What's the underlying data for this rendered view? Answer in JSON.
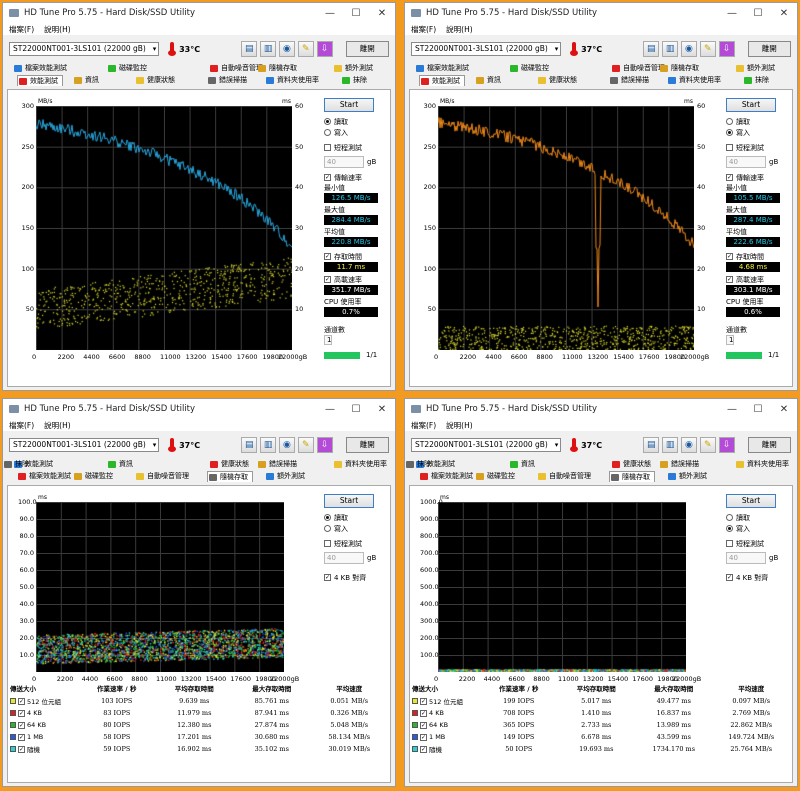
{
  "windows": [
    {
      "title": "HD Tune Pro 5.75 - Hard Disk/SSD Utility",
      "menu": [
        "檔案(F)",
        "說明(H)"
      ],
      "drive": "ST22000NT001-3LS101 (22000 gB)",
      "temperature": "33°C",
      "exit_label": "離開",
      "tabs_row1": [
        "檔案效能測試",
        "磁碟監控",
        "自動噪音管理",
        "隨機存取",
        "額外測試"
      ],
      "tabs_row2": [
        "效能測試",
        "資訊",
        "健康狀態",
        "錯誤掃描",
        "資料夾使用率",
        "抹除"
      ],
      "selected_tab": "效能測試",
      "start_label": "Start",
      "mode_options": [
        "讀取",
        "寫入"
      ],
      "mode_selected": 0,
      "short_test_label": "短程測試",
      "short_test_value": "40",
      "short_test_unit": "gB",
      "transfer_rate_label": "傳輸速率",
      "min_label": "最小值",
      "min_value": "126.5 MB/s",
      "max_label": "最大值",
      "max_value": "284.4 MB/s",
      "avg_label": "平均值",
      "avg_value": "220.8 MB/s",
      "access_label": "存取時間",
      "access_value": "11.7 ms",
      "burst_label": "高載速率",
      "burst_value": "351.7 MB/s",
      "cpu_label": "CPU 使用率",
      "cpu_value": "0.7%",
      "passes_label": "通道數",
      "passes_value": "1",
      "progress_text": "1/1",
      "progress": 1.0,
      "line_color": "#29a8e0",
      "chart_data": {
        "type": "line",
        "ylabel": "MB/s",
        "y2label": "ms",
        "ylim": [
          0,
          300
        ],
        "y2lim": [
          0,
          60
        ],
        "yticks": [
          50,
          100,
          150,
          200,
          250,
          300
        ],
        "y2ticks": [
          10,
          20,
          30,
          40,
          50,
          60
        ],
        "xticks": [
          "0",
          "2200",
          "4400",
          "6600",
          "8800",
          "11000",
          "13200",
          "15400",
          "17600",
          "19800",
          "22000gB"
        ],
        "xlim": [
          0,
          22000
        ],
        "series": [
          {
            "x": [
              0,
              2200,
              4400,
              6600,
              8800,
              11000,
              13200,
              15400,
              17600,
              19800,
              22000
            ],
            "values": [
              278,
              272,
              266,
              258,
              248,
              236,
              222,
              206,
              187,
              161,
              127
            ]
          }
        ]
      }
    },
    {
      "title": "HD Tune Pro 5.75 - Hard Disk/SSD Utility",
      "menu": [
        "檔案(F)",
        "說明(H)"
      ],
      "drive": "ST22000NT001-3LS101 (22000 gB)",
      "temperature": "37°C",
      "exit_label": "離開",
      "tabs_row1": [
        "檔案效能測試",
        "磁碟監控",
        "自動噪音管理",
        "隨機存取",
        "額外測試"
      ],
      "tabs_row2": [
        "效能測試",
        "資訊",
        "健康狀態",
        "錯誤掃描",
        "資料夾使用率",
        "抹除"
      ],
      "selected_tab": "效能測試",
      "start_label": "Start",
      "mode_options": [
        "讀取",
        "寫入"
      ],
      "mode_selected": 1,
      "short_test_label": "短程測試",
      "short_test_value": "40",
      "short_test_unit": "gB",
      "transfer_rate_label": "傳輸速率",
      "min_label": "最小值",
      "min_value": "105.5 MB/s",
      "max_label": "最大值",
      "max_value": "287.4 MB/s",
      "avg_label": "平均值",
      "avg_value": "222.6 MB/s",
      "access_label": "存取時間",
      "access_value": "4.68 ms",
      "burst_label": "高載速率",
      "burst_value": "303.1 MB/s",
      "cpu_label": "CPU 使用率",
      "cpu_value": "0.6%",
      "passes_label": "通道數",
      "passes_value": "1",
      "progress_text": "1/1",
      "progress": 1.0,
      "line_color": "#f08a1a",
      "chart_data": {
        "type": "line",
        "ylabel": "MB/s",
        "y2label": "ms",
        "ylim": [
          0,
          300
        ],
        "y2lim": [
          0,
          60
        ],
        "yticks": [
          50,
          100,
          150,
          200,
          250,
          300
        ],
        "y2ticks": [
          10,
          20,
          30,
          40,
          50,
          60
        ],
        "xticks": [
          "0",
          "2200",
          "4400",
          "6600",
          "8800",
          "11000",
          "13200",
          "15400",
          "17600",
          "19800",
          "22000gB"
        ],
        "xlim": [
          0,
          22000
        ],
        "series": [
          {
            "x": [
              0,
              2200,
              4400,
              6600,
              8800,
              11000,
              13200,
              15400,
              17600,
              19800,
              22000
            ],
            "values": [
              280,
              274,
              268,
              260,
              250,
              238,
              224,
              207,
              188,
              162,
              130
            ]
          }
        ]
      }
    },
    {
      "title": "HD Tune Pro 5.75 - Hard Disk/SSD Utility",
      "menu": [
        "檔案(F)",
        "說明(H)"
      ],
      "drive": "ST22000NT001-3LS101 (22000 gB)",
      "temperature": "37°C",
      "exit_label": "離開",
      "tabs_row1": [
        "效能測試",
        "資訊",
        "健康狀態",
        "錯誤掃描",
        "資料夾使用率",
        "抹除"
      ],
      "tabs_row2": [
        "檔案效能測試",
        "磁碟監控",
        "自動噪音管理",
        "隨機存取",
        "額外測試"
      ],
      "selected_tab": "隨機存取",
      "start_label": "Start",
      "mode_options": [
        "讀取",
        "寫入"
      ],
      "mode_selected": 0,
      "short_test_label": "短程測試",
      "short_test_value": "40",
      "short_test_unit": "gB",
      "align_label": "4 KB 對齊",
      "table_headers": [
        "傳送大小",
        "作業速率 / 秒",
        "平均存取時間",
        "最大存取時間",
        "平均速度"
      ],
      "table_rows": [
        {
          "label": "512 位元組",
          "color": "#e8e82a",
          "ops": "103 IOPS",
          "avg": "9.639 ms",
          "max": "85.761 ms",
          "speed": "0.051 MB/s"
        },
        {
          "label": "4 KB",
          "color": "#e02020",
          "ops": "83 IOPS",
          "avg": "11.979 ms",
          "max": "87.941 ms",
          "speed": "0.326 MB/s"
        },
        {
          "label": "64 KB",
          "color": "#2ab82a",
          "ops": "80 IOPS",
          "avg": "12.380 ms",
          "max": "27.874 ms",
          "speed": "5.048 MB/s"
        },
        {
          "label": "1 MB",
          "color": "#2a5ae0",
          "ops": "58 IOPS",
          "avg": "17.201 ms",
          "max": "30.680 ms",
          "speed": "58.134 MB/s"
        },
        {
          "label": "隨機",
          "color": "#2ad0d0",
          "ops": "59 IOPS",
          "avg": "16.902 ms",
          "max": "35.102 ms",
          "speed": "30.019 MB/s"
        }
      ],
      "chart_data": {
        "type": "scatter",
        "ylabel": "ms",
        "ylim": [
          0,
          100
        ],
        "yticks": [
          "10.0",
          "20.0",
          "30.0",
          "40.0",
          "50.0",
          "60.0",
          "70.0",
          "80.0",
          "90.0",
          "100.0"
        ],
        "xticks": [
          "0",
          "2200",
          "4400",
          "6600",
          "8800",
          "11000",
          "13200",
          "15400",
          "17600",
          "19800",
          "22000gB"
        ],
        "xlim": [
          0,
          22000
        ]
      }
    },
    {
      "title": "HD Tune Pro 5.75 - Hard Disk/SSD Utility",
      "menu": [
        "檔案(F)",
        "說明(H)"
      ],
      "drive": "ST22000NT001-3LS101 (22000 gB)",
      "temperature": "37°C",
      "exit_label": "離開",
      "tabs_row1": [
        "效能測試",
        "資訊",
        "健康狀態",
        "錯誤掃描",
        "資料夾使用率",
        "抹除"
      ],
      "tabs_row2": [
        "檔案效能測試",
        "磁碟監控",
        "自動噪音管理",
        "隨機存取",
        "額外測試"
      ],
      "selected_tab": "隨機存取",
      "start_label": "Start",
      "mode_options": [
        "讀取",
        "寫入"
      ],
      "mode_selected": 1,
      "short_test_label": "短程測試",
      "short_test_value": "40",
      "short_test_unit": "gB",
      "align_label": "4 KB 對齊",
      "table_headers": [
        "傳送大小",
        "作業速率 / 秒",
        "平均存取時間",
        "最大存取時間",
        "平均速度"
      ],
      "table_rows": [
        {
          "label": "512 位元組",
          "color": "#e8e82a",
          "ops": "199 IOPS",
          "avg": "5.017 ms",
          "max": "49.477 ms",
          "speed": "0.097 MB/s"
        },
        {
          "label": "4 KB",
          "color": "#e02020",
          "ops": "708 IOPS",
          "avg": "1.410 ms",
          "max": "16.837 ms",
          "speed": "2.769 MB/s"
        },
        {
          "label": "64 KB",
          "color": "#2ab82a",
          "ops": "365 IOPS",
          "avg": "2.733 ms",
          "max": "13.989 ms",
          "speed": "22.862 MB/s"
        },
        {
          "label": "1 MB",
          "color": "#2a5ae0",
          "ops": "149 IOPS",
          "avg": "6.678 ms",
          "max": "43.599 ms",
          "speed": "149.724 MB/s"
        },
        {
          "label": "隨機",
          "color": "#2ad0d0",
          "ops": "50 IOPS",
          "avg": "19.693 ms",
          "max": "1734.170 ms",
          "speed": "25.764 MB/s"
        }
      ],
      "chart_data": {
        "type": "scatter",
        "ylabel": "ms",
        "ylim": [
          0,
          1000
        ],
        "yticks": [
          "100.0",
          "200.0",
          "300.0",
          "400.0",
          "500.0",
          "600.0",
          "700.0",
          "800.0",
          "900.0",
          "1000.0"
        ],
        "xticks": [
          "0",
          "2200",
          "4400",
          "6600",
          "8800",
          "11000",
          "13200",
          "15400",
          "17600",
          "19800",
          "22000gB"
        ],
        "xlim": [
          0,
          22000
        ]
      }
    }
  ]
}
